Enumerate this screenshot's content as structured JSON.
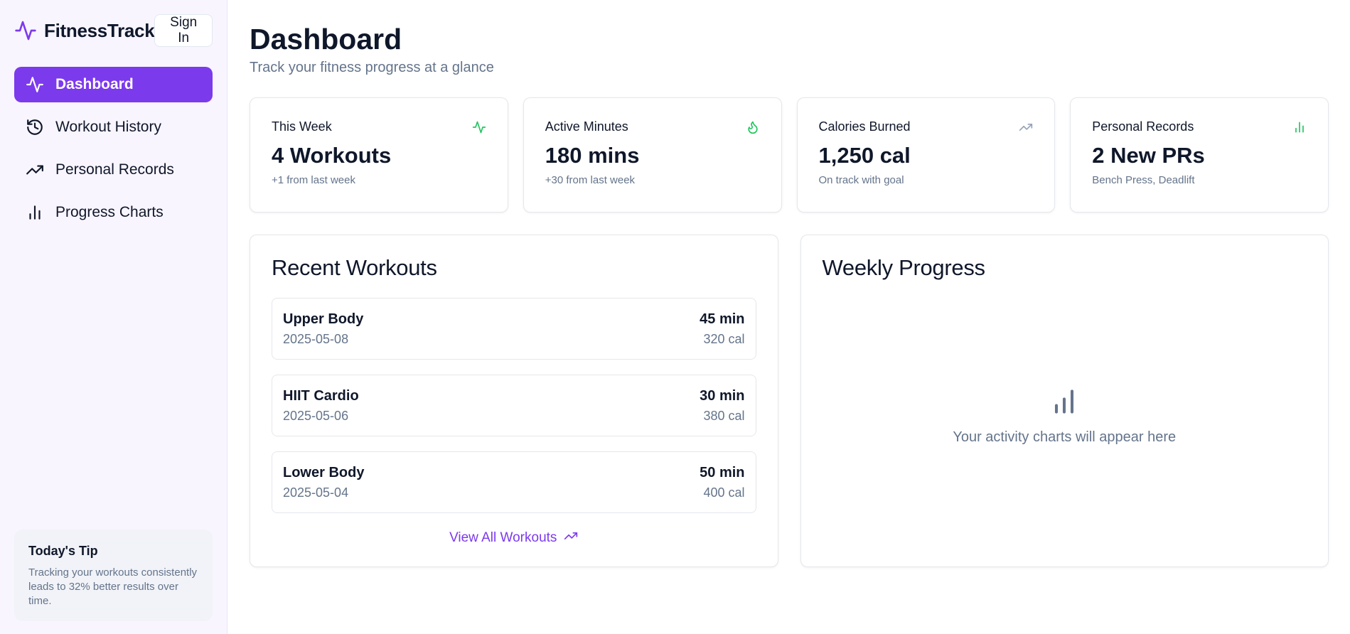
{
  "brand": {
    "name": "FitnessTrack",
    "signin_label": "Sign In"
  },
  "nav": [
    {
      "label": "Dashboard",
      "icon": "activity-icon",
      "active": true
    },
    {
      "label": "Workout History",
      "icon": "history-icon",
      "active": false
    },
    {
      "label": "Personal Records",
      "icon": "trending-up-icon",
      "active": false
    },
    {
      "label": "Progress Charts",
      "icon": "bar-chart-icon",
      "active": false
    }
  ],
  "tip": {
    "title": "Today's Tip",
    "body": "Tracking your workouts consistently leads to 32% better results over time."
  },
  "header": {
    "title": "Dashboard",
    "subtitle": "Track your fitness progress at a glance"
  },
  "stats": [
    {
      "label": "This Week",
      "value": "4 Workouts",
      "sub": "+1 from last week",
      "icon": "activity-icon",
      "icon_color": "#22c55e"
    },
    {
      "label": "Active Minutes",
      "value": "180 mins",
      "sub": "+30 from last week",
      "icon": "flame-icon",
      "icon_color": "#22c55e"
    },
    {
      "label": "Calories Burned",
      "value": "1,250 cal",
      "sub": "On track with goal",
      "icon": "trending-up-icon",
      "icon_color": "#94a3b8"
    },
    {
      "label": "Personal Records",
      "value": "2 New PRs",
      "sub": "Bench Press, Deadlift",
      "icon": "bar-chart-icon",
      "icon_color": "#22c55e"
    }
  ],
  "recent": {
    "title": "Recent Workouts",
    "items": [
      {
        "name": "Upper Body",
        "date": "2025-05-08",
        "duration": "45 min",
        "calories": "320 cal"
      },
      {
        "name": "HIIT Cardio",
        "date": "2025-05-06",
        "duration": "30 min",
        "calories": "380 cal"
      },
      {
        "name": "Lower Body",
        "date": "2025-05-04",
        "duration": "50 min",
        "calories": "400 cal"
      }
    ],
    "view_all_label": "View All Workouts"
  },
  "weekly": {
    "title": "Weekly Progress",
    "empty_text": "Your activity charts will appear here"
  },
  "colors": {
    "accent": "#7c3aed",
    "success": "#22c55e",
    "muted": "#64748b"
  }
}
